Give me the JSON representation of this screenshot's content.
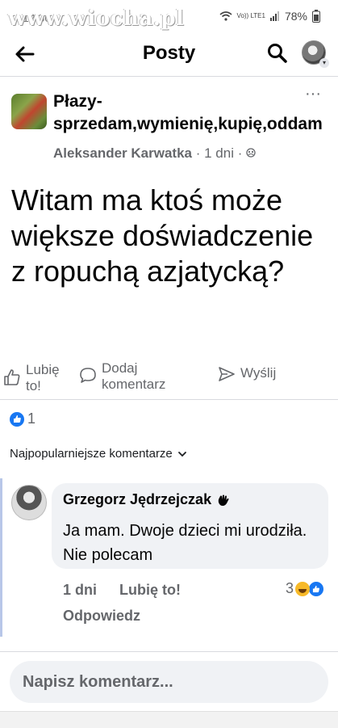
{
  "status_bar": {
    "time": "12:30",
    "network": "Vo)) LTE1",
    "battery": "78%"
  },
  "watermark": "www.wiocha.pl",
  "header": {
    "title": "Posty"
  },
  "post": {
    "group_name": "Płazy-sprzedam,wymienię,kupię,oddam",
    "author": "Aleksander Karwatka",
    "separator": "·",
    "time": "1 dni",
    "text": "Witam ma ktoś może większe doświadczenie z ropuchą azjatycką?",
    "actions": {
      "like": "Lubię to!",
      "comment": "Dodaj komentarz",
      "share": "Wyślij"
    },
    "reaction_count": "1"
  },
  "comments": {
    "sort_label": "Najpopularniejsze komentarze",
    "items": [
      {
        "author": "Grzegorz Jędrzejczak",
        "text": "Ja mam. Dwoje dzieci mi urodziła. Nie polecam",
        "time": "1 dni",
        "like_label": "Lubię to!",
        "reply_label": "Odpowiedz",
        "reaction_count": "3"
      }
    ]
  },
  "composer": {
    "placeholder": "Napisz komentarz..."
  },
  "colors": {
    "accent": "#1877f2",
    "secondary_text": "#65676b",
    "bubble": "#f0f2f5"
  }
}
